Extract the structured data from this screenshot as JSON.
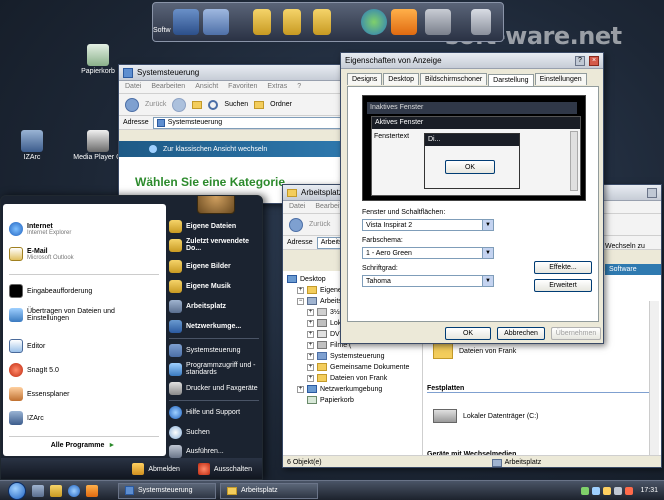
{
  "watermark": "soft-ware.net",
  "dock": {
    "label": "Softw"
  },
  "desktop_icons": [
    {
      "label": "Papierkorb"
    },
    {
      "label": "IZArc"
    },
    {
      "label": "Media Player Cl"
    }
  ],
  "control_panel": {
    "title": "Systemsteuerung",
    "menu": [
      "Datei",
      "Bearbeiten",
      "Ansicht",
      "Favoriten",
      "Extras",
      "?"
    ],
    "back": "Zurück",
    "search": "Suchen",
    "folders": "Ordner",
    "address_label": "Adresse",
    "address_value": "Systemsteuerung",
    "classic_view": "Zur klassischen Ansicht wechseln",
    "heading": "Wählen Sie eine Kategorie"
  },
  "arbeitsplatz": {
    "title": "Arbeitsplatz",
    "menu": [
      "Datei",
      "Bearbeit"
    ],
    "back": "Zurück",
    "address_label": "Adresse",
    "address_value": "Arbeitsplatz",
    "tree": [
      "Desktop",
      "Eigene Do",
      "Arbeitspla",
      "3½-Di",
      "Lokale",
      "DVD-",
      "Filme (",
      "Systemsteuerung",
      "Gemeinsame Dokumente",
      "Dateien von Frank",
      "Netzwerkumgebung",
      "Papierkorb"
    ],
    "right_link": "Wechseln zu",
    "right_badge": "Software",
    "files_item": "Dateien von Frank",
    "section_disks": "Festplatten",
    "disk_item": "Lokaler Datenträger (C:)",
    "section_removable": "Geräte mit Wechselmedien",
    "status_left": "6 Objekt(e)",
    "status_right": "Arbeitsplatz"
  },
  "dialog": {
    "title": "Eigenschaften von Anzeige",
    "tabs": [
      "Designs",
      "Desktop",
      "Bildschirmschoner",
      "Darstellung",
      "Einstellungen"
    ],
    "preview": {
      "inactive": "Inaktives Fenster",
      "active": "Aktives Fenster",
      "window_text": "Fenstertext",
      "msg_title": "Di...",
      "ok": "OK"
    },
    "label_windows": "Fenster und Schaltflächen:",
    "value_windows": "Vista Inspirat 2",
    "label_colors": "Farbschema:",
    "value_colors": "1 - Aero Green",
    "label_font": "Schriftgrad:",
    "value_font": "Tahoma",
    "effects": "Effekte...",
    "advanced": "Erweitert",
    "ok": "OK",
    "cancel": "Abbrechen",
    "apply": "Übernehmen"
  },
  "start_menu": {
    "left": [
      {
        "title": "Internet",
        "sub": "Internet Explorer"
      },
      {
        "title": "E-Mail",
        "sub": "Microsoft Outlook"
      },
      {
        "title": "Eingabeaufforderung",
        "sub": ""
      },
      {
        "title": "Übertragen von Dateien und Einstellungen",
        "sub": ""
      },
      {
        "title": "Editor",
        "sub": ""
      },
      {
        "title": "SnagIt 5.0",
        "sub": ""
      },
      {
        "title": "Essensplaner",
        "sub": ""
      },
      {
        "title": "IZArc",
        "sub": ""
      }
    ],
    "all_programs": "Alle Programme",
    "right": [
      "Eigene Dateien",
      "Zuletzt verwendete Do...",
      "Eigene Bilder",
      "Eigene Musik",
      "Arbeitsplatz",
      "Netzwerkumge...",
      "Systemsteuerung",
      "Programmzugriff und -standards",
      "Drucker und Faxgeräte",
      "Hilfe und Support",
      "Suchen",
      "Ausführen..."
    ],
    "logoff": "Abmelden",
    "shutdown": "Ausschalten"
  },
  "taskbar": {
    "tasks": [
      "Systemsteuerung",
      "Arbeitsplatz"
    ],
    "clock": "17:31"
  },
  "colors": {
    "xp_green_heading": "#2c8a2c",
    "aero_green": "#3aa24a",
    "dialog_bg": "#ece9d8"
  }
}
